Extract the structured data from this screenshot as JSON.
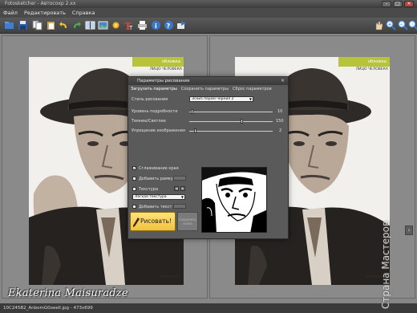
{
  "window": {
    "title": "Fotosketcher - Автосохр 2.xx",
    "controls": [
      "minimize",
      "maximize",
      "close"
    ]
  },
  "menu": {
    "items": [
      "Файл",
      "Редактировать",
      "Справка"
    ]
  },
  "toolbar": {
    "left_icons": [
      "open-icon",
      "save-icon",
      "copy-icon",
      "paste-icon",
      "undo-icon",
      "redo-icon",
      "compare-icon",
      "image-icon",
      "effects-icon",
      "text-icon",
      "print-icon",
      "info-icon",
      "help-icon",
      "export-icon"
    ],
    "right_icons": [
      "hand-icon",
      "zoom-in-icon",
      "zoom-out-icon",
      "zoom-fit-icon"
    ]
  },
  "photo": {
    "tag": "обложка",
    "subtitle": "ЛИЦО ЧЕЛОВЕКА",
    "footer": "обложка  39"
  },
  "dialog": {
    "title": "Параметры рисования",
    "tabs": [
      "Загрузить параметры",
      "Сохранить параметры",
      "Сброс параметров"
    ],
    "style_label": "Стиль рисования",
    "style_value": "Эскиз пером чернил 2",
    "sliders": [
      {
        "label": "Уровень подробности",
        "value": 10
      },
      {
        "label": "Темнее/Светлее",
        "value": 150
      },
      {
        "label": "Упрощение изображения",
        "value": 2
      }
    ],
    "smooth_edges_label": "Сглаживание края",
    "smooth_edges_checked": true,
    "add_frame_label": "Добавить рамку",
    "texture_label": "Текстура",
    "texture_value": "Легкая текстура",
    "add_text_label": "Добавить текст",
    "draw_button": "Рисовать!",
    "save_button": "Сохранить эскиз"
  },
  "statusbar": {
    "path": "10C245B2_AnbomG0oeell.jpg - 473x699"
  },
  "watermark": {
    "signature": "Ekaterina Maisuradze",
    "site": "Страна Мастеров"
  },
  "colors": {
    "accent": "#f0c33c",
    "tag_green": "#b7c43a",
    "toolbar": "#4a4a4a"
  }
}
